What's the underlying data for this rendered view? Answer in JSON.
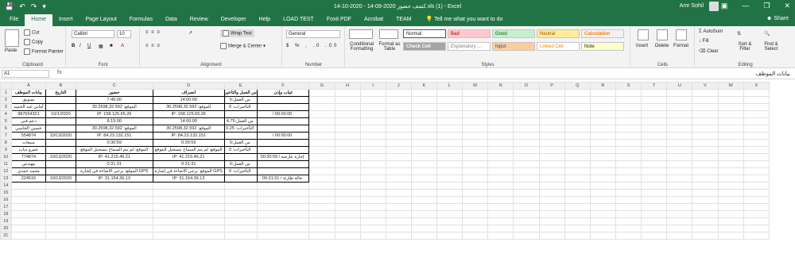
{
  "title": "14-10-2020 - 14-09-2020 كشف حضور.xls (1) - Excel",
  "user": "Amr Sohil",
  "tabs": [
    "File",
    "Home",
    "Insert",
    "Page Layout",
    "Formulas",
    "Data",
    "Review",
    "Developer",
    "Help",
    "LOAD TEST",
    "Foxit PDF",
    "Acrobat",
    "TEAM"
  ],
  "tell_me": "Tell me what you want to do",
  "share": "Share",
  "ribbon": {
    "clipboard": {
      "paste": "Paste",
      "cut": "Cut",
      "copy": "Copy",
      "format_painter": "Format Painter",
      "label": "Clipboard"
    },
    "font": {
      "name": "Calibri",
      "size": "10",
      "label": "Font"
    },
    "alignment": {
      "wrap_text": "Wrap Text",
      "merge_center": "Merge & Center",
      "label": "Alignment"
    },
    "number": {
      "format": "General",
      "label": "Number"
    },
    "styles": {
      "conditional": "Conditional Formatting",
      "format_as_table": "Format as Table",
      "items": [
        "Normal",
        "Bad",
        "Good",
        "Neutral",
        "Calculation",
        "Check Cell",
        "Explanatory ...",
        "Input",
        "Linked Cell",
        "Note"
      ],
      "label": "Styles"
    },
    "cells": {
      "insert": "Insert",
      "delete": "Delete",
      "format": "Format",
      "label": "Cells"
    },
    "editing": {
      "autosum": "AutoSum",
      "fill": "Fill",
      "clear": "Clear",
      "sort_filter": "Sort & Filter",
      "find_select": "Find & Select",
      "label": "Editing"
    }
  },
  "formula_bar": {
    "name_box": "A1",
    "fx": "fx",
    "content": "بيانات الموظف"
  },
  "columns": [
    "A",
    "B",
    "C",
    "D",
    "E",
    "F",
    "G",
    "H",
    "I",
    "J",
    "K",
    "L",
    "M",
    "N",
    "O",
    "P",
    "Q",
    "R",
    "S",
    "T",
    "U",
    "V",
    "W",
    "X"
  ],
  "rows": [
    "1",
    "2",
    "3",
    "4",
    "5",
    "6",
    "7",
    "8",
    "9",
    "10",
    "11",
    "12",
    "13",
    "14",
    "15",
    "16",
    "17",
    "18",
    "19",
    "20",
    "21",
    "22",
    "23",
    "24"
  ],
  "sheet": {
    "header": [
      "بيانات الموظف",
      "التاريخ",
      "حضور",
      "انصراف",
      "س العمل والتاخير",
      "غياب وإذن"
    ],
    "r2": [
      "تسويق",
      "",
      "7:45:00",
      "14:00:00",
      "س العمل:5",
      ""
    ],
    "r3": [
      "أماني عبد الحميد",
      "",
      "الموقع: 30.2598,32.592",
      "الموقع: 30.2598,32.592",
      "التأخيرات: 0",
      ""
    ],
    "r4": [
      "987654321",
      "10/1/2020",
      "IP: 158.125.65.26",
      "IP: 158.125.65.26",
      "",
      "/ 00:00:00"
    ],
    "r5": [
      "دعم فني",
      "",
      "8:15:00",
      "14:00:00",
      "س العمل:4.75",
      ""
    ],
    "r6": [
      "حسين الجاسي",
      "",
      "الموقع: 30.2598,32.592",
      "الموقع: 30.2598,32.592",
      "التأخيرات: 0.25",
      ""
    ],
    "r7": [
      "554874",
      "10/13/2020",
      "IP: 84.23.132.151",
      "IP: 84.23.132.151",
      "",
      "/ 00:00:00"
    ],
    "r8": [
      "مبيعات",
      "",
      "0:30:59",
      "0:30:59",
      "س العمل:0",
      ""
    ],
    "r9": [
      "عمرو دياب",
      "",
      "الموقع: لم يتم السماح بتسجيل الموقع",
      "الموقع: لم يتم السماح بتسجيل الموقع",
      "التأخيرات: 0",
      ""
    ],
    "r10": [
      "774874",
      "10/13/2020",
      "IP: 41.215.46.21",
      "IP: 41.215.46.21",
      "",
      "إجازة عارضة / 00:30:59"
    ],
    "r11": [
      "مهندس",
      "",
      "0:31:31",
      "0:31:31",
      "س العمل:0",
      ""
    ],
    "r12": [
      "محمد حمدي",
      "",
      "الموقع: يرجى الاضاءة في إشارة GPS",
      "الموقع: يرجى الاضاءة في إشارة GPS",
      "التأخيرات: 0",
      ""
    ],
    "r13": [
      "224516",
      "10/13/2020",
      "IP: 31.154.36.13",
      "IP: 31.154.36.13",
      "",
      "حالة طارئة / 00:31:31"
    ]
  },
  "colors": {
    "excel_green": "#217346",
    "bad_fill": "#ffc7ce",
    "good_fill": "#c6efce",
    "neutral_fill": "#ffeb9c",
    "calc_fill": "#f2f2f2",
    "check_fill": "#a5a5a5",
    "input_fill": "#ffcc99",
    "note_fill": "#ffffcc"
  }
}
